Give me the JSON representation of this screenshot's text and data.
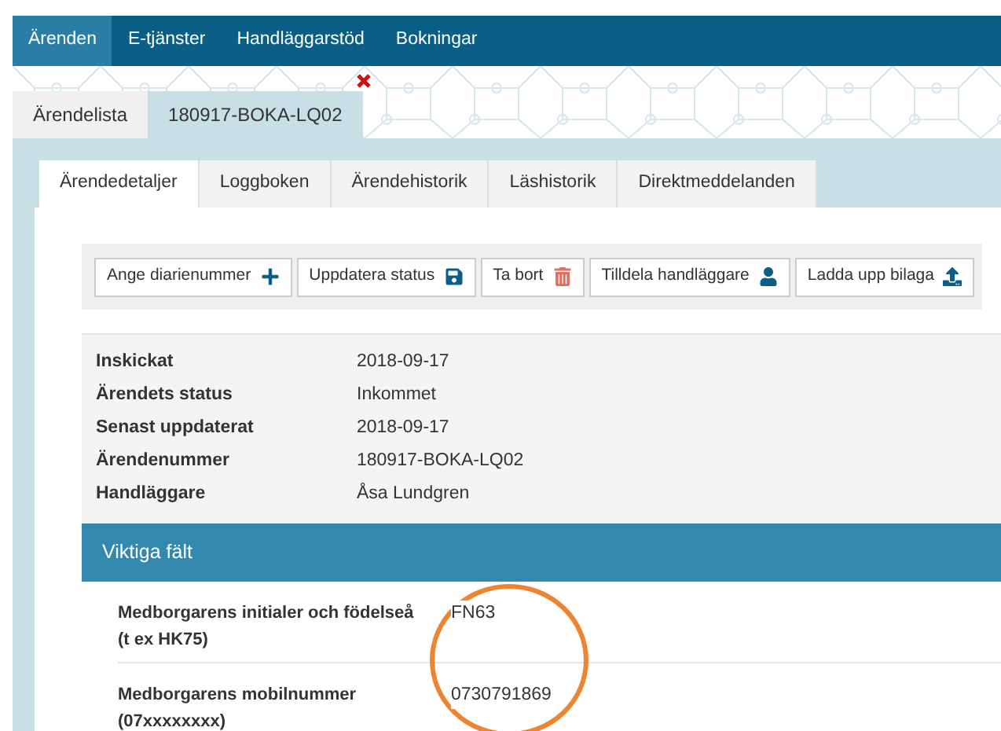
{
  "nav": [
    {
      "label": "Ärenden",
      "selected": true
    },
    {
      "label": "E-tjänster",
      "selected": false
    },
    {
      "label": "Handläggarstöd",
      "selected": false
    },
    {
      "label": "Bokningar",
      "selected": false
    }
  ],
  "case_tabs": [
    {
      "label": "Ärendelista",
      "selected": false,
      "closable": false
    },
    {
      "label": "180917-BOKA-LQ02",
      "selected": true,
      "closable": true
    }
  ],
  "sub_tabs": [
    {
      "label": "Ärendedetaljer",
      "selected": true
    },
    {
      "label": "Loggboken",
      "selected": false
    },
    {
      "label": "Ärendehistorik",
      "selected": false
    },
    {
      "label": "Läshistorik",
      "selected": false
    },
    {
      "label": "Direktmeddelanden",
      "selected": false
    }
  ],
  "toolbar": [
    "Ange diarienummer",
    "Uppdatera status",
    "Ta bort",
    "Tilldela handläggare",
    "Ladda upp bilaga"
  ],
  "details": [
    {
      "label": "Inskickat",
      "value": "2018-09-17"
    },
    {
      "label": "Ärendets status",
      "value": "Inkommet"
    },
    {
      "label": "Senast uppdaterat",
      "value": "2018-09-17"
    },
    {
      "label": "Ärendenummer",
      "value": "180917-BOKA-LQ02"
    },
    {
      "label": "Handläggare",
      "value": "Åsa Lundgren"
    }
  ],
  "important_fields": {
    "title": "Viktiga fält",
    "rows": [
      {
        "label": "Medborgarens initialer och födelseå",
        "hint": "(t ex HK75)",
        "value": "FN63"
      },
      {
        "label": "Medborgarens mobilnummer",
        "hint": "(07xxxxxxxx)",
        "value": "0730791869"
      }
    ]
  },
  "annotation": {
    "circled": true
  }
}
